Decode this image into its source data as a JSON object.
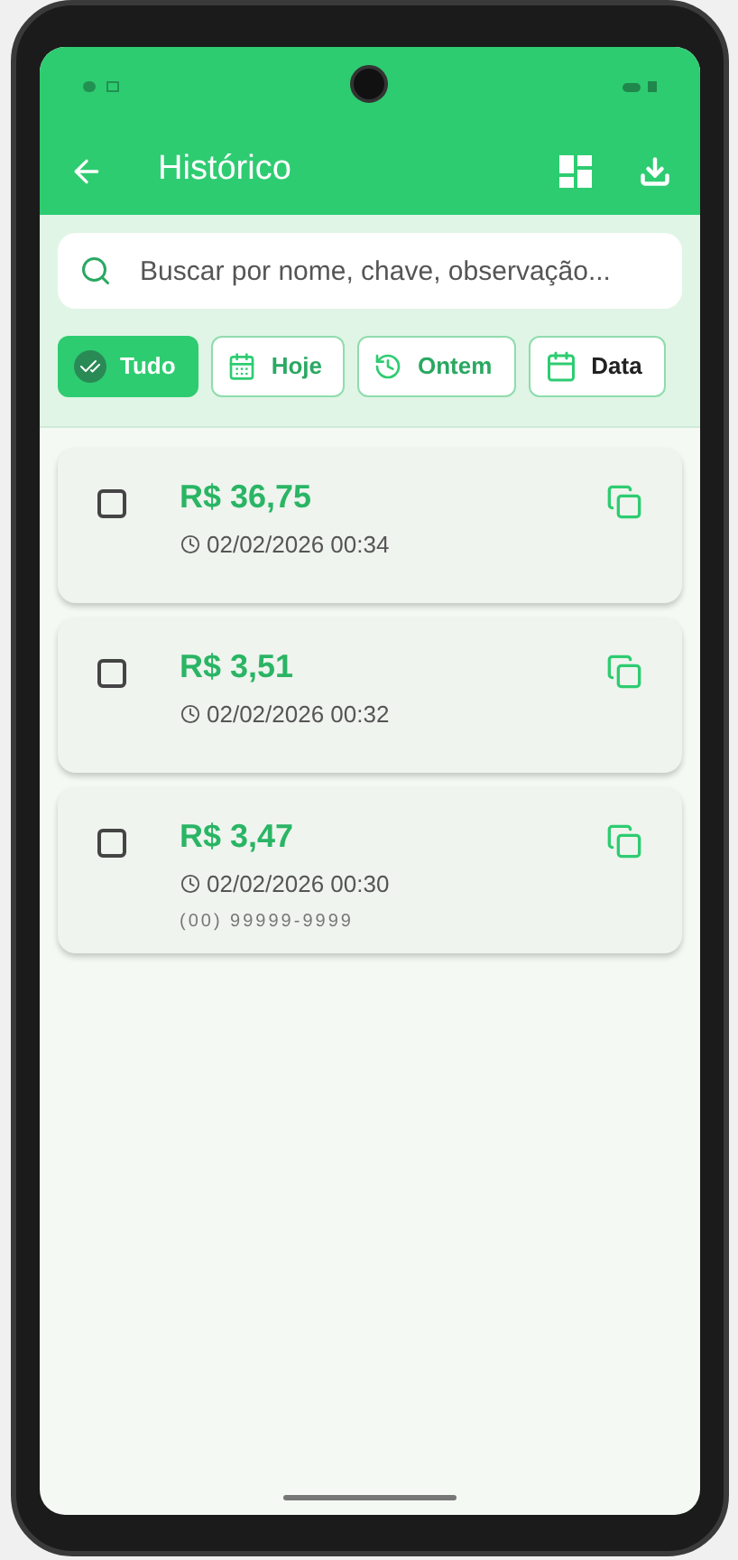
{
  "app_bar": {
    "title": "Histórico"
  },
  "search": {
    "placeholder": "Buscar por nome, chave, observação..."
  },
  "filters": [
    {
      "label": "Tudo",
      "kind": "all",
      "selected": true
    },
    {
      "label": "Hoje",
      "kind": "today",
      "selected": false
    },
    {
      "label": "Ontem",
      "kind": "yesterday",
      "selected": false
    },
    {
      "label": "Data",
      "kind": "date",
      "selected": false
    }
  ],
  "transactions": [
    {
      "amount": "R$ 36,75",
      "datetime": "02/02/2026 00:34",
      "checked": false
    },
    {
      "amount": "R$ 3,51",
      "datetime": "02/02/2026 00:32",
      "checked": false
    },
    {
      "amount": "R$ 3,47",
      "datetime": "02/02/2026 00:30",
      "note": "(00) 99999-9999",
      "checked": false
    }
  ]
}
